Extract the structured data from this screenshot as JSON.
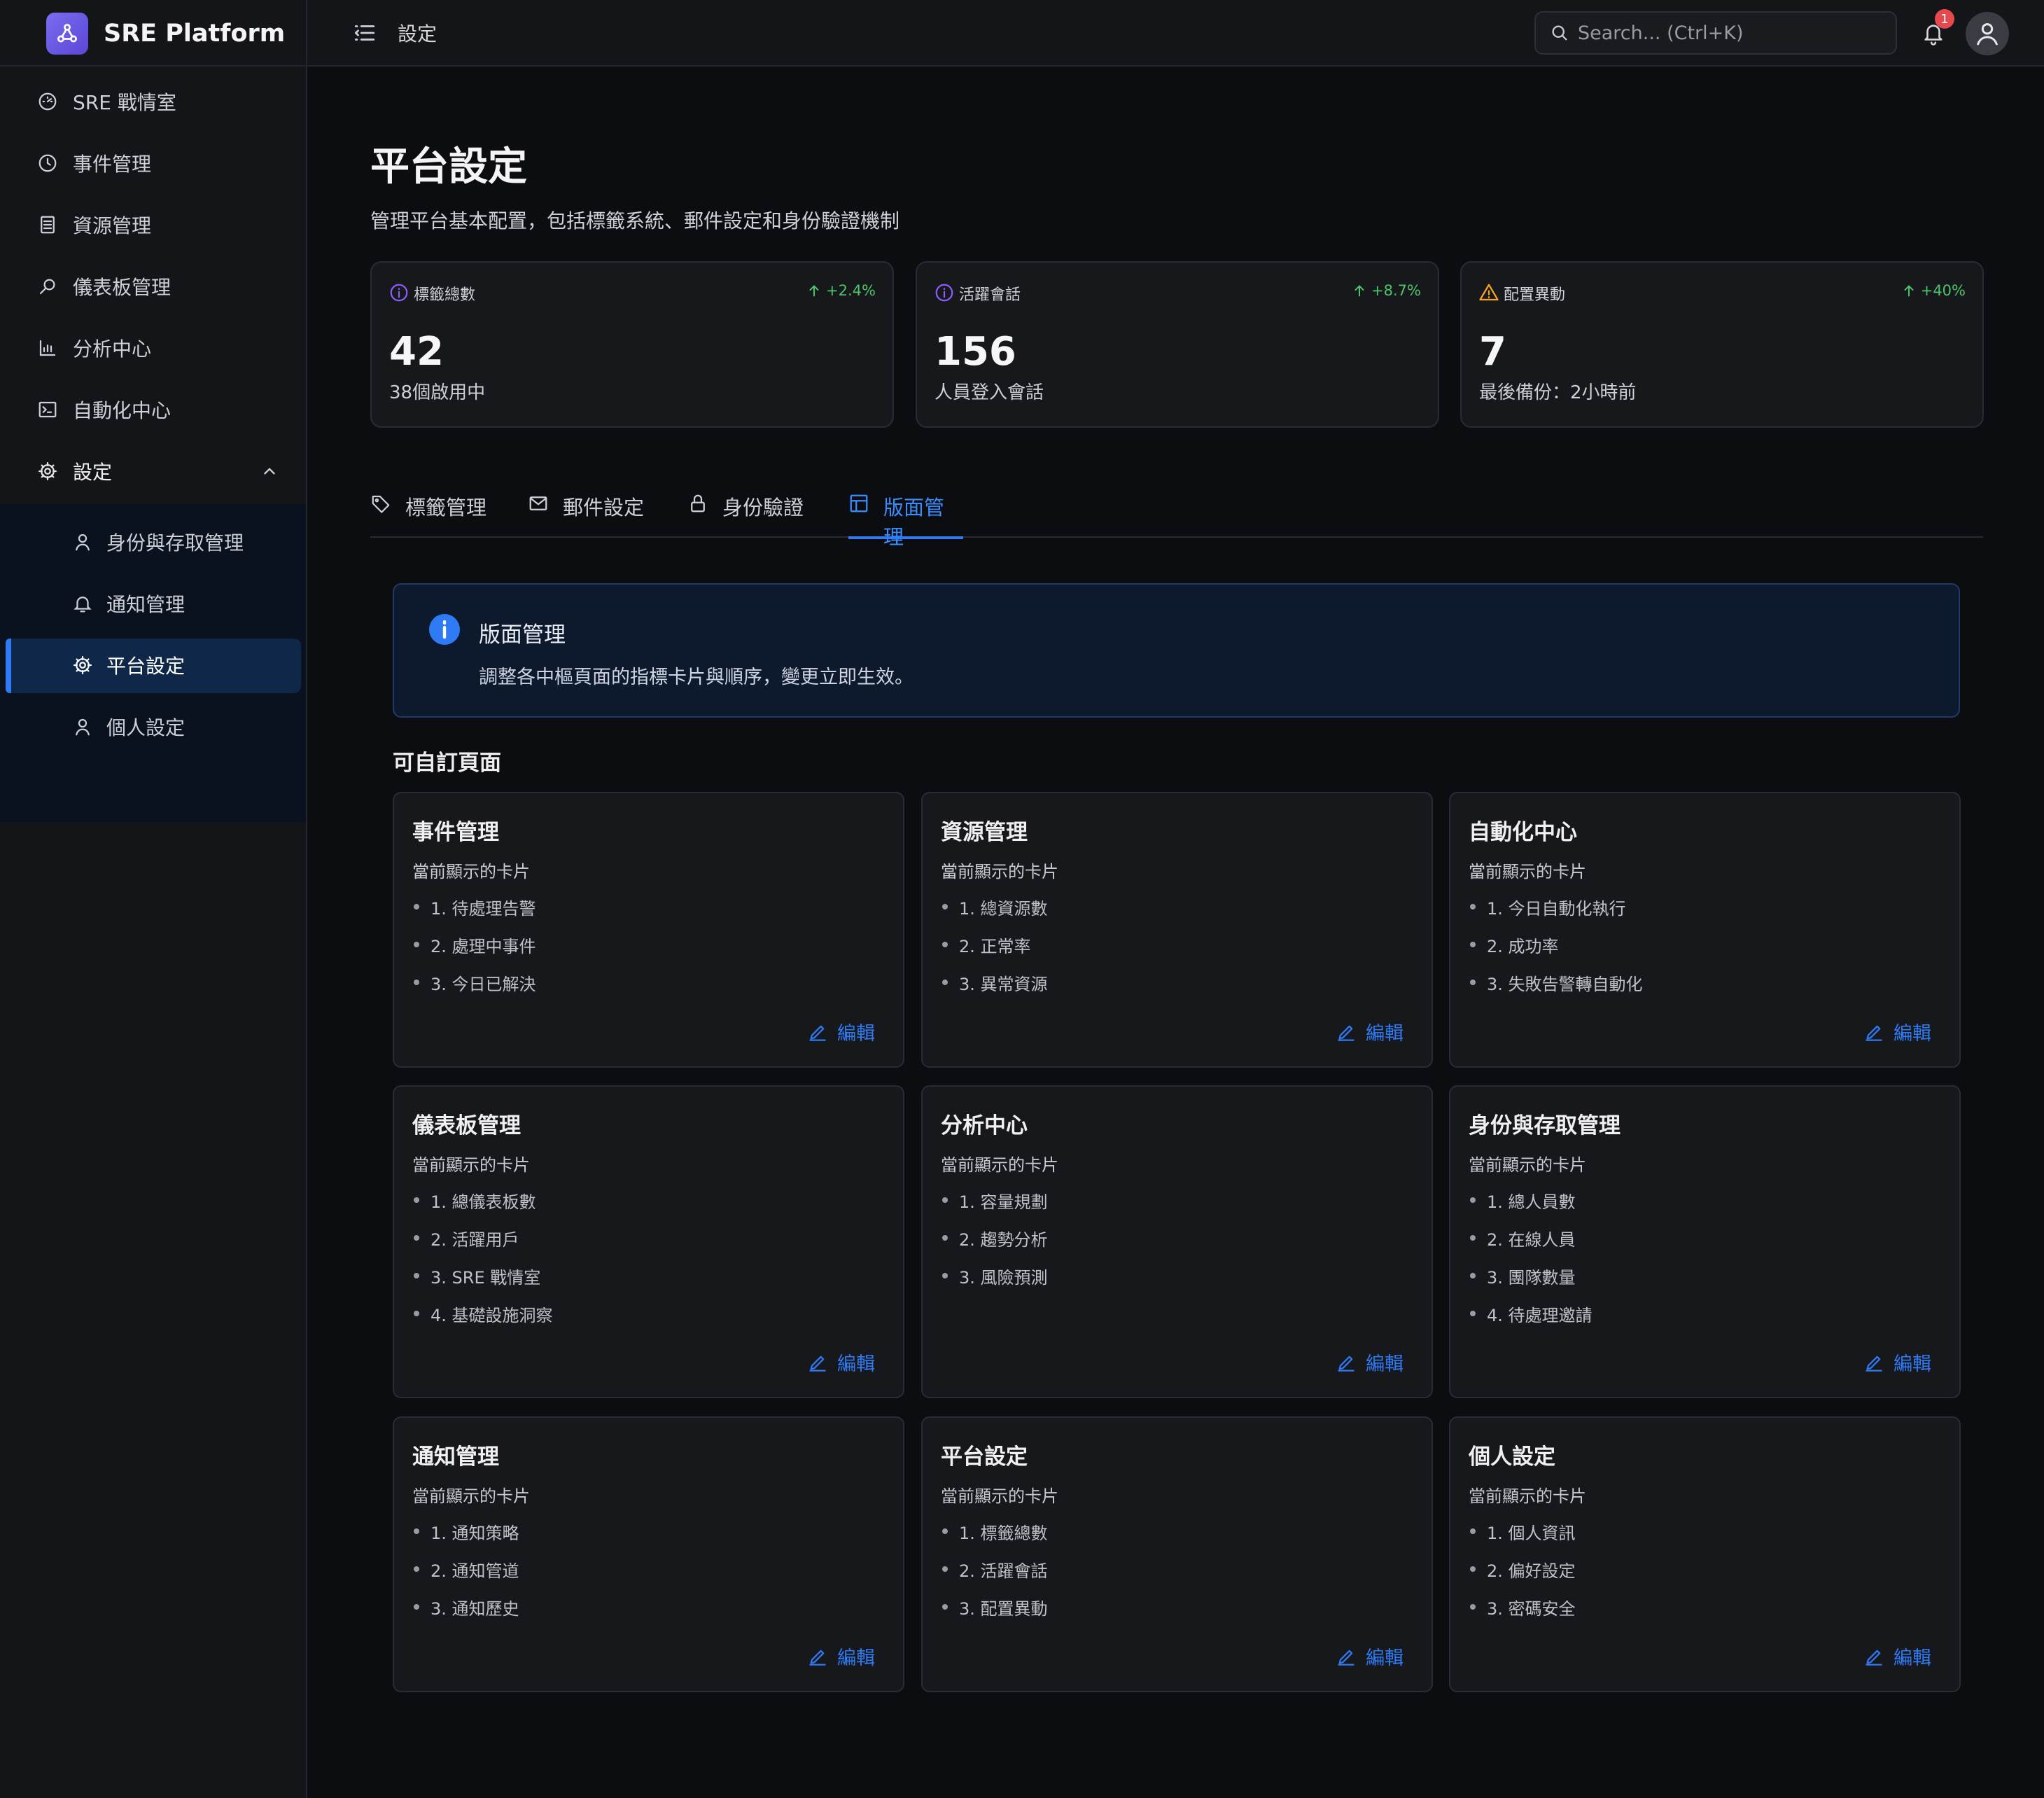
{
  "brand": {
    "name": "SRE Platform"
  },
  "topbar": {
    "title": "設定",
    "search_placeholder": "Search... (Ctrl+K)",
    "notification_count": "1"
  },
  "sidebar": {
    "items": [
      {
        "label": "SRE 戰情室",
        "icon": "gauge-icon"
      },
      {
        "label": "事件管理",
        "icon": "clock-icon"
      },
      {
        "label": "資源管理",
        "icon": "server-icon"
      },
      {
        "label": "儀表板管理",
        "icon": "search-icon"
      },
      {
        "label": "分析中心",
        "icon": "bar-chart-icon"
      },
      {
        "label": "自動化中心",
        "icon": "terminal-icon"
      },
      {
        "label": "設定",
        "icon": "gear-icon"
      }
    ],
    "sub_items": [
      {
        "label": "身份與存取管理",
        "icon": "user-icon"
      },
      {
        "label": "通知管理",
        "icon": "bell-icon"
      },
      {
        "label": "平台設定",
        "icon": "gear-icon",
        "active": true
      },
      {
        "label": "個人設定",
        "icon": "user-icon"
      }
    ]
  },
  "page": {
    "title": "平台設定",
    "description": "管理平台基本配置，包括標籤系統、郵件設定和身份驗證機制"
  },
  "stats": [
    {
      "label": "標籤總數",
      "trend": "+2.4%",
      "value": "42",
      "sub": "38個啟用中",
      "icon": "info-icon",
      "icon_color": "#8b5cf6"
    },
    {
      "label": "活躍會話",
      "trend": "+8.7%",
      "value": "156",
      "sub": "人員登入會話",
      "icon": "info-icon",
      "icon_color": "#8b5cf6"
    },
    {
      "label": "配置異動",
      "trend": "+40%",
      "value": "7",
      "sub": "最後備份：2小時前",
      "icon": "warning-icon",
      "icon_color": "#f5a524"
    }
  ],
  "tabs": [
    {
      "label": "標籤管理",
      "icon": "tag-icon"
    },
    {
      "label": "郵件設定",
      "icon": "mail-icon"
    },
    {
      "label": "身份驗證",
      "icon": "lock-icon"
    },
    {
      "label": "版面管理",
      "icon": "layout-icon",
      "active": true
    }
  ],
  "info_banner": {
    "title": "版面管理",
    "description": "調整各中樞頁面的指標卡片與順序，變更立即生效。"
  },
  "section_title": "可自訂頁面",
  "cards_subtitle": "當前顯示的卡片",
  "edit_label": "編輯",
  "cards": [
    {
      "title": "事件管理",
      "items": [
        "1. 待處理告警",
        "2. 處理中事件",
        "3. 今日已解決"
      ]
    },
    {
      "title": "資源管理",
      "items": [
        "1. 總資源數",
        "2. 正常率",
        "3. 異常資源"
      ]
    },
    {
      "title": "自動化中心",
      "items": [
        "1. 今日自動化執行",
        "2. 成功率",
        "3. 失敗告警轉自動化"
      ]
    },
    {
      "title": "儀表板管理",
      "items": [
        "1. 總儀表板數",
        "2. 活躍用戶",
        "3. SRE 戰情室",
        "4. 基礎設施洞察"
      ]
    },
    {
      "title": "分析中心",
      "items": [
        "1. 容量規劃",
        "2. 趨勢分析",
        "3. 風險預測"
      ]
    },
    {
      "title": "身份與存取管理",
      "items": [
        "1. 總人員數",
        "2. 在線人員",
        "3. 團隊數量",
        "4. 待處理邀請"
      ]
    },
    {
      "title": "通知管理",
      "items": [
        "1. 通知策略",
        "2. 通知管道",
        "3. 通知歷史"
      ]
    },
    {
      "title": "平台設定",
      "items": [
        "1. 標籤總數",
        "2. 活躍會話",
        "3. 配置異動"
      ]
    },
    {
      "title": "個人設定",
      "items": [
        "1. 個人資訊",
        "2. 偏好設定",
        "3. 密碼安全"
      ]
    }
  ],
  "colors": {
    "accent": "#2f7bf5",
    "trend_up": "#4cc46a",
    "background": "#0c0d11",
    "panel": "#17181c"
  }
}
